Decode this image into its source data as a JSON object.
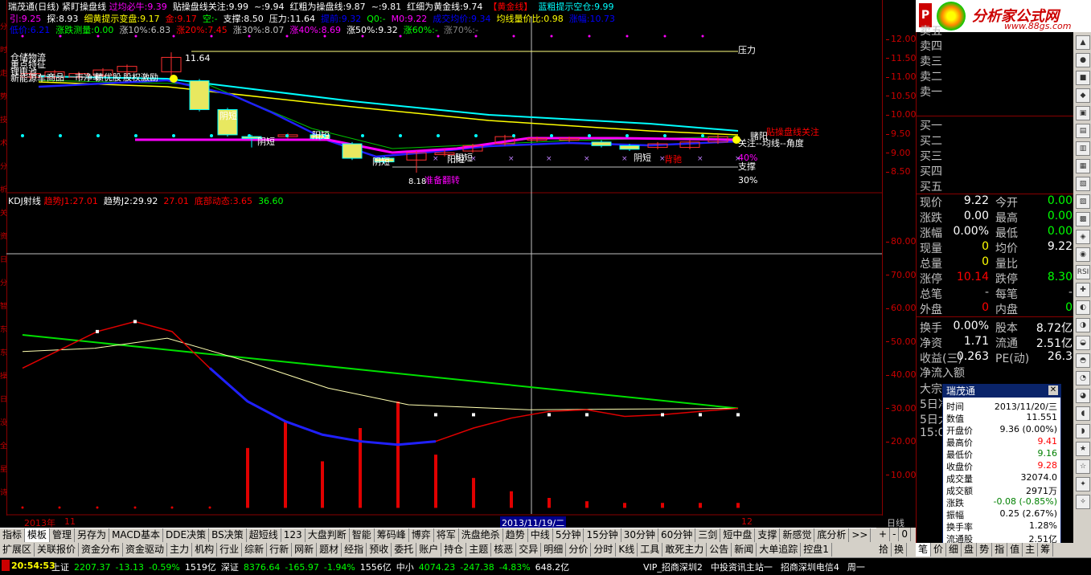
{
  "header": {
    "title": "瑞茂通(日线)",
    "indicator": "紧盯操盘线",
    "items": [
      {
        "label": "过均必牛:",
        "value": "9.39",
        "color": "#ff00ff"
      },
      {
        "label": "贴操盘线关注:",
        "value": "9.99",
        "color": "#ffffff"
      },
      {
        "label": "~:",
        "value": "9.94",
        "color": "#ffffff"
      },
      {
        "label": "红粗为操盘线:",
        "value": "9.87",
        "color": "#ffffff"
      },
      {
        "label": "~:",
        "value": "9.81",
        "color": "#ffffff"
      },
      {
        "label": "红细为黄金线:",
        "value": "9.74",
        "color": "#ffffff"
      },
      {
        "label": "【黄金线】",
        "value": "",
        "color": "#ff0000"
      },
      {
        "label": "蓝粗提示空仓:",
        "value": "9.99",
        "color": "#00ffff"
      }
    ],
    "row2": [
      {
        "label": "引:",
        "value": "9.25",
        "color": "#ff00ff"
      },
      {
        "label": "探:",
        "value": "8.93",
        "color": "#ffffff"
      },
      {
        "label": "细黄提示变盘:",
        "value": "9.17",
        "color": "#ffff00"
      },
      {
        "label": "金:",
        "value": "9.17",
        "color": "#ff0000"
      },
      {
        "label": "空:",
        "value": "-",
        "color": "#00ff00"
      },
      {
        "label": "支撑:",
        "value": "8.50",
        "color": "#ffffff"
      },
      {
        "label": "压力:",
        "value": "11.64",
        "color": "#ffffff"
      },
      {
        "label": "提前:",
        "value": "9.32",
        "color": "#0000ff"
      },
      {
        "label": "Q0:",
        "value": "-",
        "color": "#00ff00"
      },
      {
        "label": "M0:",
        "value": "9.22",
        "color": "#ff00ff"
      },
      {
        "label": "成交均价:",
        "value": "9.34",
        "color": "#0000ff"
      },
      {
        "label": "均线量价比:",
        "value": "0.98",
        "color": "#ffff00"
      },
      {
        "label": "涨幅:",
        "value": "10.73",
        "color": "#0000ff"
      }
    ],
    "row3": [
      {
        "label": "低价:",
        "value": "6.21",
        "color": "#0000ff"
      },
      {
        "label": "涨跌测量:",
        "value": "0.00",
        "color": "#00ff00"
      },
      {
        "label": "涨10%:",
        "value": "6.83",
        "color": "#c0c0c0"
      },
      {
        "label": "涨20%:",
        "value": "7.45",
        "color": "#ff0000"
      },
      {
        "label": "涨30%:",
        "value": "8.07",
        "color": "#c0c0c0"
      },
      {
        "label": "涨40%:",
        "value": "8.69",
        "color": "#ff00ff"
      },
      {
        "label": "涨50%:",
        "value": "9.32",
        "color": "#ffffff"
      },
      {
        "label": "涨60%:",
        "value": "-",
        "color": "#00ff00"
      },
      {
        "label": "涨70%:",
        "value": "-",
        "color": "#808080"
      }
    ]
  },
  "main_chart": {
    "price_axis": [
      "12.00",
      "11.50",
      "11.00",
      "10.50",
      "10.00",
      "9.50",
      "9.00",
      "8.50"
    ],
    "annotations": [
      "仓储物流",
      "重点特征",
      "锂电池",
      "新能源车",
      "商品",
      "市净率",
      "绩优股",
      "股权激励",
      "阳短",
      "阴短",
      "阳短",
      "阴短",
      "阴短",
      "阴短",
      "阳短",
      "赌阳",
      "关注--均线--角度",
      "支撑",
      "压力",
      "40%",
      "30%",
      "准备翻转",
      "贴操盘线关注",
      "背驰"
    ],
    "high_label": "11.64",
    "low_label": "8.18"
  },
  "kdj": {
    "title": "KDJ射线",
    "items": [
      {
        "label": "趋势J1:",
        "value": "27.01",
        "color": "#ff0000"
      },
      {
        "label": "趋势J2:",
        "value": "29.92",
        "color": "#ffffff"
      },
      {
        "label": "",
        "value": "27.01",
        "color": "#ff0000"
      },
      {
        "label": "底部动态:",
        "value": "3.65",
        "color": "#ff0000"
      },
      {
        "label": "",
        "value": "36.60",
        "color": "#00ff00"
      }
    ],
    "axis": [
      "80.00",
      "70.00",
      "60.00",
      "50.00",
      "40.00",
      "30.00",
      "20.00",
      "10.00"
    ]
  },
  "date_axis": {
    "left": "2013年",
    "mid1": "11",
    "cursor": "2013/11/19/二",
    "right": "12",
    "period": "日线"
  },
  "quote": {
    "asks": [
      "卖五",
      "卖四",
      "卖三",
      "卖二",
      "卖一"
    ],
    "bids": [
      "买一",
      "买二",
      "买三",
      "买四",
      "买五"
    ],
    "rows": [
      {
        "l1": "现价",
        "v1": "9.22",
        "c1": "#ffffff",
        "l2": "今开",
        "v2": "0.00",
        "c2": "#00ff00"
      },
      {
        "l1": "涨跌",
        "v1": "0.00",
        "c1": "#ffffff",
        "l2": "最高",
        "v2": "0.00",
        "c2": "#00ff00"
      },
      {
        "l1": "涨幅",
        "v1": "0.00%",
        "c1": "#ffffff",
        "l2": "最低",
        "v2": "0.00",
        "c2": "#00ff00"
      },
      {
        "l1": "现量",
        "v1": "0",
        "c1": "#ffff00",
        "l2": "均价",
        "v2": "9.22",
        "c2": "#ffffff"
      },
      {
        "l1": "总量",
        "v1": "0",
        "c1": "#ffff00",
        "l2": "量比",
        "v2": "",
        "c2": "#ffffff"
      },
      {
        "l1": "涨停",
        "v1": "10.14",
        "c1": "#ff0000",
        "l2": "跌停",
        "v2": "8.30",
        "c2": "#00ff00"
      },
      {
        "l1": "总笔",
        "v1": "-",
        "c1": "#c0c0c0",
        "l2": "每笔",
        "v2": "-",
        "c2": "#c0c0c0"
      },
      {
        "l1": "外盘",
        "v1": "0",
        "c1": "#ff0000",
        "l2": "内盘",
        "v2": "0",
        "c2": "#00ff00"
      },
      {
        "l1": "换手",
        "v1": "0.00%",
        "c1": "#ffffff",
        "l2": "股本",
        "v2": "8.72亿",
        "c2": "#ffffff"
      },
      {
        "l1": "净资",
        "v1": "1.71",
        "c1": "#ffffff",
        "l2": "流通",
        "v2": "2.51亿",
        "c2": "#ffffff"
      },
      {
        "l1": "收益(三)",
        "v1": "0.263",
        "c1": "#ffffff",
        "l2": "PE(动)",
        "v2": "26.3",
        "c2": "#ffffff"
      }
    ],
    "flow_title": "净流入额",
    "flow_rows": [
      "大宗",
      "5日净",
      "5日大"
    ],
    "time": "15:0"
  },
  "popup": {
    "title": "瑞茂通",
    "rows": [
      {
        "l": "时间",
        "v": "2013/11/20/三",
        "c": "#000000"
      },
      {
        "l": "数值",
        "v": "11.551",
        "c": "#000000"
      },
      {
        "l": "开盘价",
        "v": "9.36 (0.00%)",
        "c": "#000000"
      },
      {
        "l": "最高价",
        "v": "9.41",
        "c": "#ff0000"
      },
      {
        "l": "最低价",
        "v": "9.16",
        "c": "#008000"
      },
      {
        "l": "收盘价",
        "v": "9.28",
        "c": "#ff0000"
      },
      {
        "l": "成交量",
        "v": "32074.0",
        "c": "#000000"
      },
      {
        "l": "成交额",
        "v": "2971万",
        "c": "#000000"
      },
      {
        "l": "涨跌",
        "v": "-0.08 (-0.85%)",
        "c": "#008000"
      },
      {
        "l": "振幅",
        "v": "0.25 (2.67%)",
        "c": "#000000"
      },
      {
        "l": "换手率",
        "v": "1.28%",
        "c": "#000000"
      },
      {
        "l": "流通股",
        "v": "2.51亿",
        "c": "#000000"
      }
    ]
  },
  "logo": {
    "text": "分析家公式网",
    "url_text": "www.88gs.com"
  },
  "tabs1": [
    "指标",
    "模板",
    "管理",
    "另存为",
    "MACD基本",
    "DDE决策",
    "BS决策",
    "超短线",
    "123",
    "大盘判断",
    "智能",
    "筹码峰",
    "博弈",
    "将军",
    "洗盘绝杀",
    "趋势",
    "中线",
    "5分钟",
    "15分钟",
    "30分钟",
    "60分钟",
    "三剑",
    "短中盘",
    "支撑",
    "新感觉",
    "底分析",
    ">>"
  ],
  "tabs1_right": [
    "+",
    "-",
    "0"
  ],
  "tabs2": [
    "扩展区",
    "关联报价",
    "资金分布",
    "资金驱动",
    "主力",
    "机构",
    "行业",
    "综新",
    "行新",
    "网新",
    "题材",
    "经指",
    "预收",
    "委托",
    "账户",
    "持仓",
    "主题",
    "核恶",
    "交异",
    "明细",
    "分价",
    "分时",
    "K线",
    "工具",
    "敢死主力",
    "公告",
    "新闻",
    "大单追踪",
    "控盘1"
  ],
  "tabs2_right": [
    "拾",
    "换"
  ],
  "tabs3": [
    "笔",
    "价",
    "细",
    "盘",
    "势",
    "指",
    "值",
    "主",
    "筹"
  ],
  "status": {
    "time": "20:54:53",
    "items": [
      {
        "t": "上证",
        "c": "#ffffff"
      },
      {
        "t": "2207.37",
        "c": "#00ff00"
      },
      {
        "t": "-13.13",
        "c": "#00ff00"
      },
      {
        "t": "-0.59%",
        "c": "#00ff00"
      },
      {
        "t": "1519亿",
        "c": "#ffffff"
      },
      {
        "t": "深证",
        "c": "#ffffff"
      },
      {
        "t": "8376.64",
        "c": "#00ff00"
      },
      {
        "t": "-165.97",
        "c": "#00ff00"
      },
      {
        "t": "-1.94%",
        "c": "#00ff00"
      },
      {
        "t": "1556亿",
        "c": "#ffffff"
      },
      {
        "t": "中小",
        "c": "#ffffff"
      },
      {
        "t": "4074.23",
        "c": "#00ff00"
      },
      {
        "t": "-247.38",
        "c": "#00ff00"
      },
      {
        "t": "-4.83%",
        "c": "#00ff00"
      },
      {
        "t": "648.2亿",
        "c": "#ffffff"
      }
    ],
    "right": [
      "VIP_招商深圳2",
      "中投资讯主站一",
      "招商深圳电信4",
      "周一"
    ]
  },
  "leftbar": [
    "分",
    "时",
    "走",
    "势",
    "技",
    "术",
    "分",
    "析",
    "关",
    "资",
    "日",
    "分",
    "智",
    "东",
    "东",
    "操",
    "日",
    "没",
    "全",
    "星",
    "诗"
  ]
}
